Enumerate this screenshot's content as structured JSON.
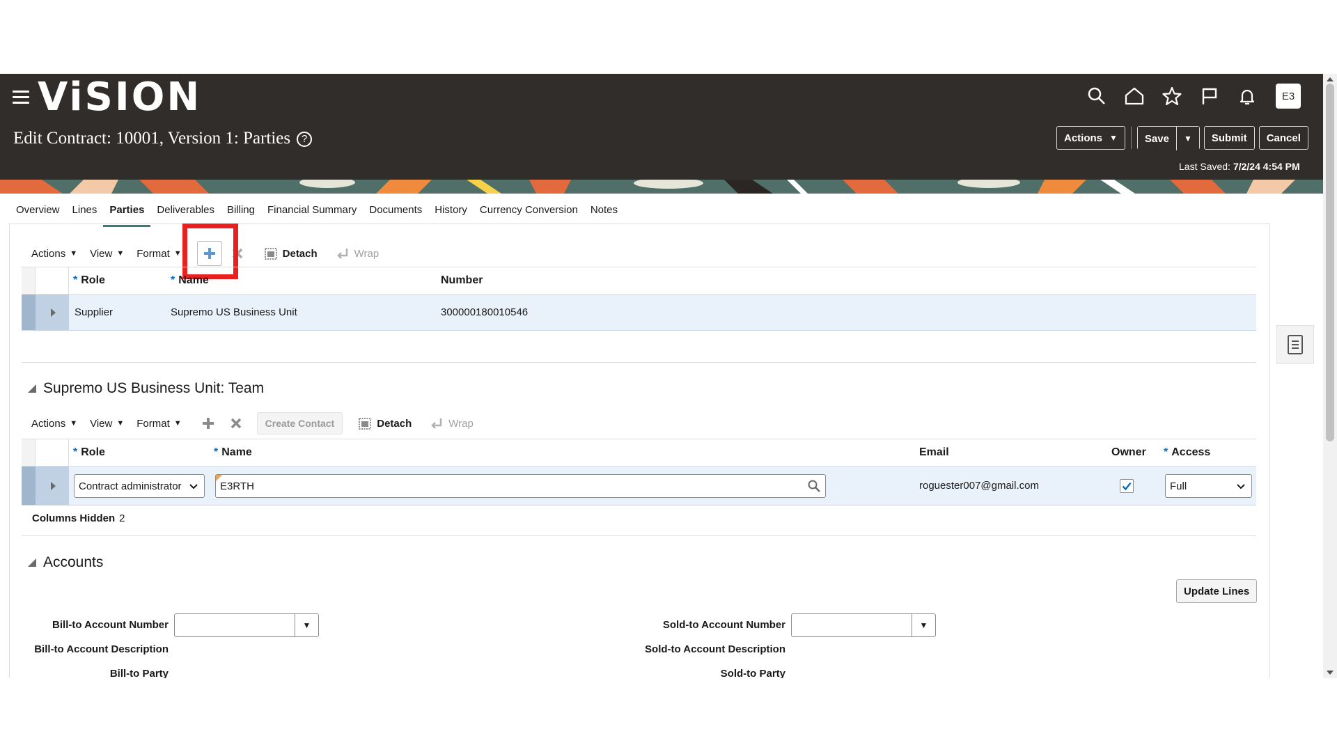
{
  "app": {
    "logo": "ViSION",
    "page_title": "Edit Contract: 10001, Version 1: Parties",
    "help": "?",
    "avatar": "E3",
    "last_saved_label": "Last Saved:",
    "last_saved_value": "7/2/24 4:54 PM"
  },
  "header_buttons": {
    "actions": "Actions",
    "save": "Save",
    "submit": "Submit",
    "cancel": "Cancel"
  },
  "tabs": [
    "Overview",
    "Lines",
    "Parties",
    "Deliverables",
    "Billing",
    "Financial Summary",
    "Documents",
    "History",
    "Currency Conversion",
    "Notes"
  ],
  "active_tab": "Parties",
  "parties_toolbar": {
    "actions": "Actions",
    "view": "View",
    "format": "Format",
    "detach": "Detach",
    "wrap": "Wrap"
  },
  "parties_table": {
    "columns": [
      "Role",
      "Name",
      "Number"
    ],
    "rows": [
      {
        "role": "Supplier",
        "name": "Supremo US Business Unit",
        "number": "300000180010546"
      }
    ]
  },
  "team": {
    "title": "Supremo US Business Unit: Team",
    "toolbar": {
      "actions": "Actions",
      "view": "View",
      "format": "Format",
      "create_contact": "Create Contact",
      "detach": "Detach",
      "wrap": "Wrap"
    },
    "columns": [
      "Role",
      "Name",
      "Email",
      "Owner",
      "Access"
    ],
    "row": {
      "role": "Contract administrator",
      "name": "E3RTH",
      "email": "roguester007@gmail.com",
      "owner": true,
      "access": "Full"
    },
    "columns_hidden_label": "Columns Hidden",
    "columns_hidden_count": "2"
  },
  "accounts": {
    "title": "Accounts",
    "update_lines": "Update Lines",
    "bill_to_account_number": "Bill-to Account Number",
    "bill_to_account_description": "Bill-to Account Description",
    "bill_to_party": "Bill-to Party",
    "sold_to_account_number": "Sold-to Account Number",
    "sold_to_account_description": "Sold-to Account Description",
    "sold_to_party": "Sold-to Party"
  },
  "colors": {
    "header_bg": "#312d2a",
    "selected_row": "#e9f1fa",
    "highlight": "#e82020",
    "required_star": "#0b6ec4"
  }
}
